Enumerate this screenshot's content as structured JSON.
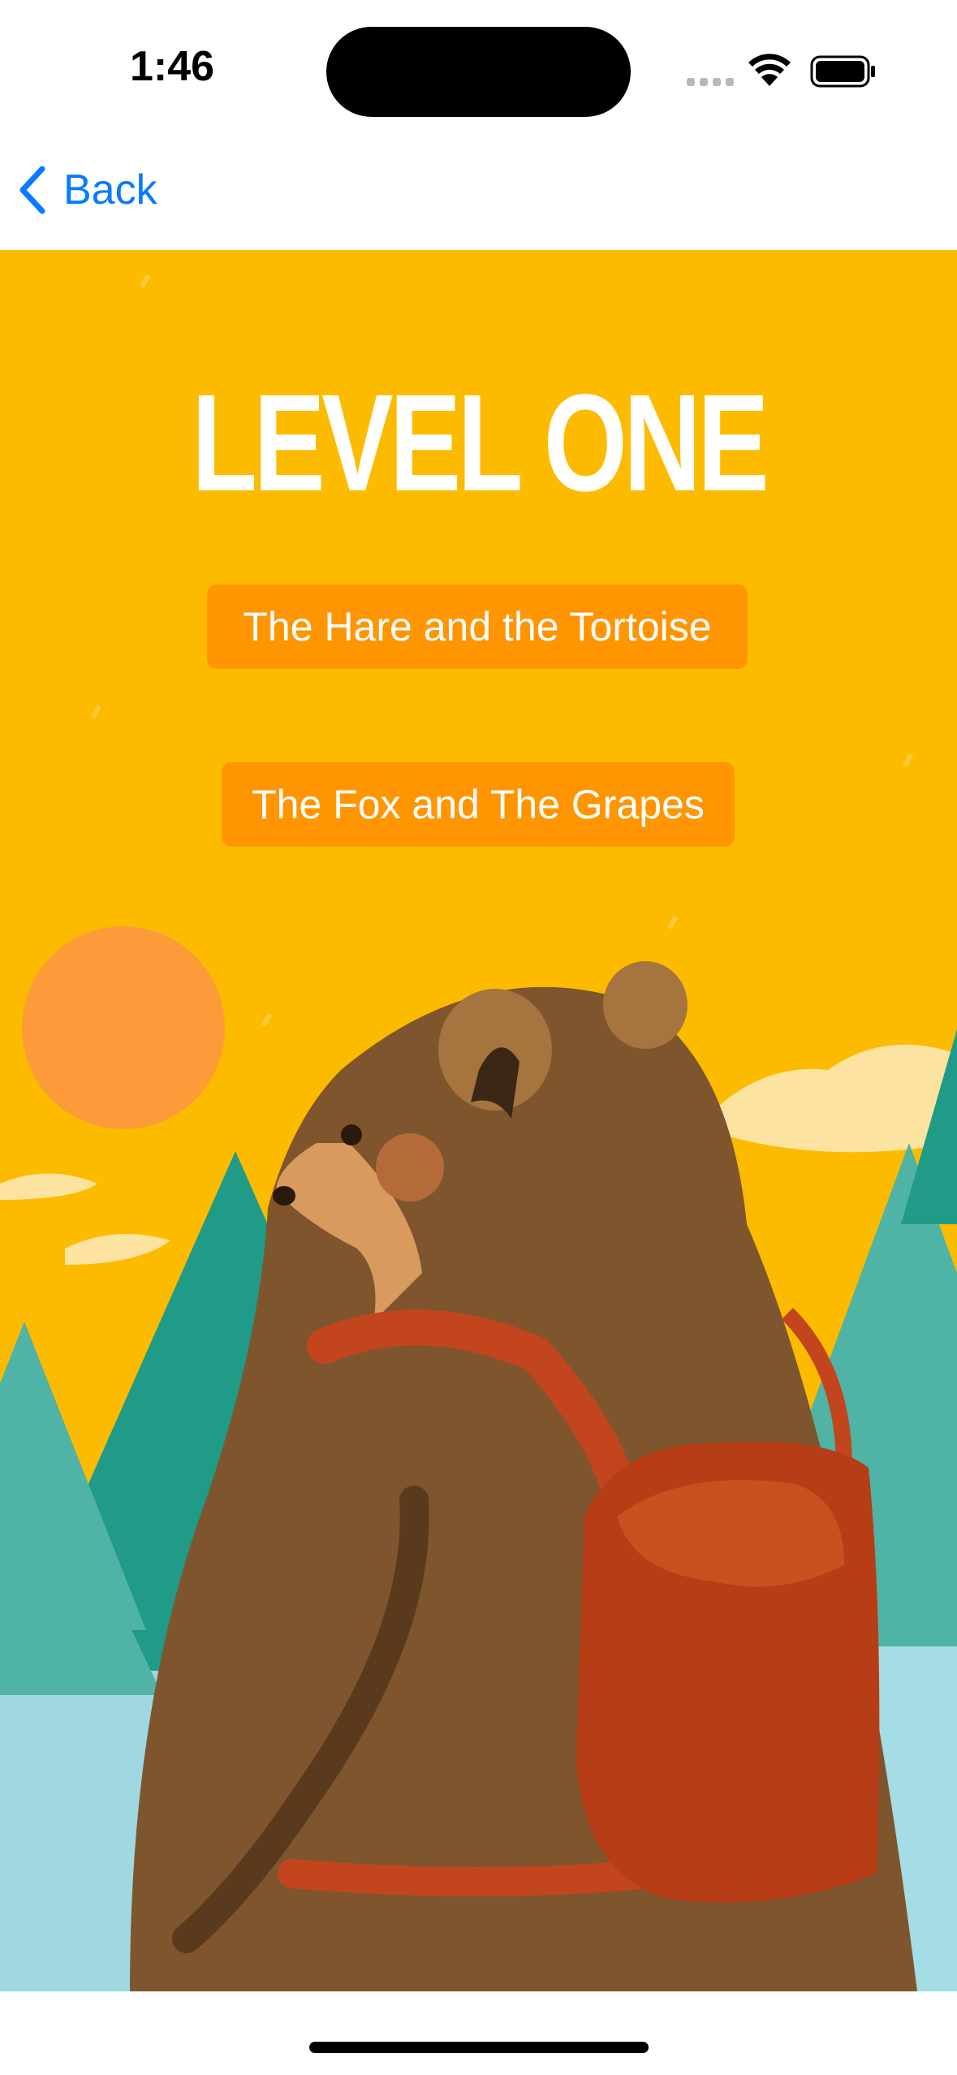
{
  "status_bar": {
    "time": "1:46",
    "icons": [
      "signal-icon",
      "wifi-icon",
      "battery-icon"
    ]
  },
  "nav": {
    "back_label": "Back",
    "back_icon": "chevron-left-icon",
    "accent_color": "#0a7aff"
  },
  "hero": {
    "title": "LEVEL ONE",
    "background_color": "#fdbb00",
    "illustration": "bear-with-backpack-illustration"
  },
  "stories": [
    {
      "label": "The Hare and the Tortoise"
    },
    {
      "label": "The Fox and The Grapes"
    }
  ],
  "button_color": "#ff9500"
}
